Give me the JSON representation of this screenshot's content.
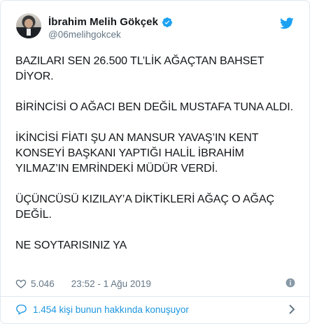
{
  "author": {
    "name": "İbrahim Melih Gökçek",
    "handle": "@06melihgokcek"
  },
  "tweet": {
    "paragraphs": [
      "BAZILARI SEN 26.500 TL’LİK AĞAÇTAN BAHSET DİYOR.",
      "BİRİNCİSİ O AĞACI BEN DEĞİL MUSTAFA TUNA ALDI.",
      "İKİNCİSİ FİATI ŞU AN MANSUR YAVAŞ’IN KENT KONSEYİ BAŞKANI YAPTIĞI HALİL İBRAHİM YILMAZ’IN EMRİNDEKİ MÜDÜR VERDİ.",
      "ÜÇÜNCÜSÜ KIZILAY’A DİKTİKLERİ AĞAÇ O AĞAÇ DEĞİL.",
      "NE SOYTARISINIZ YA"
    ],
    "likes": "5.046",
    "timestamp": "23:52 - 1 Ağu 2019"
  },
  "footer": {
    "conversation_label": "1.454 kişi bunun hakkında konuşuyor"
  },
  "icons": {
    "verified": "verified-badge-icon",
    "brand": "twitter-bird-icon",
    "like": "heart-icon",
    "info": "info-icon",
    "reply": "speech-bubble-icon",
    "more": "chevron-right-icon"
  },
  "colors": {
    "accent": "#1da1f2",
    "link": "#1b95e0",
    "muted": "#657786",
    "text": "#14171a",
    "border": "#e1e8ed"
  }
}
